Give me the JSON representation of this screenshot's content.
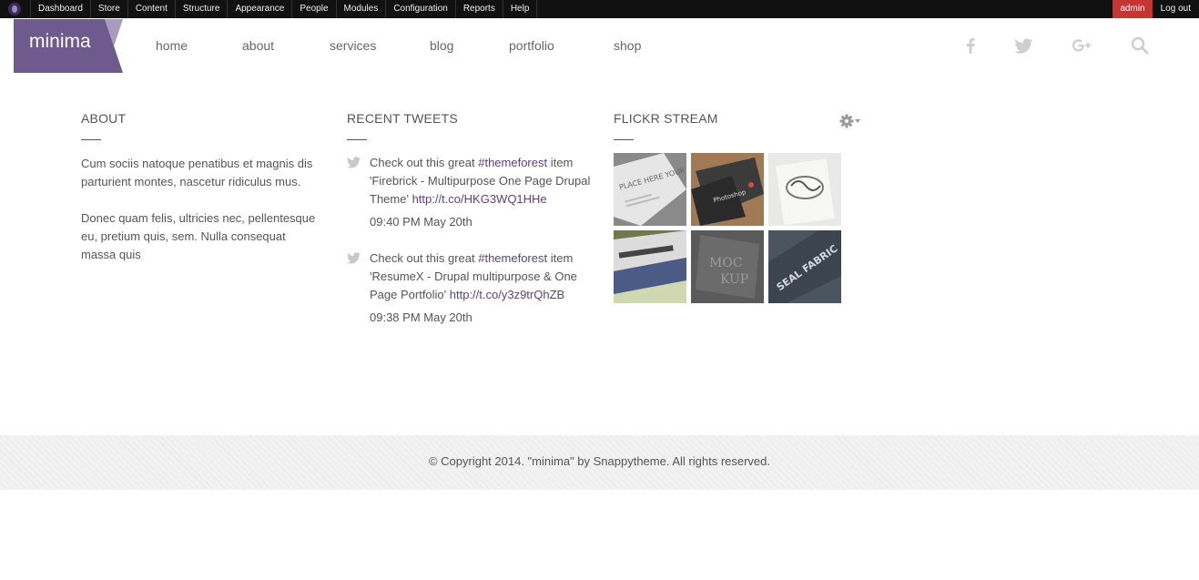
{
  "toolbar": {
    "items": [
      "Dashboard",
      "Store",
      "Content",
      "Structure",
      "Appearance",
      "People",
      "Modules",
      "Configuration",
      "Reports",
      "Help"
    ],
    "user": "admin",
    "logout": "Log out"
  },
  "header": {
    "logo": "minima",
    "nav": [
      "home",
      "about",
      "services",
      "blog",
      "portfolio",
      "shop"
    ],
    "social_icons": [
      "facebook-icon",
      "twitter-icon",
      "google-plus-icon",
      "search-icon"
    ]
  },
  "about": {
    "title": "ABOUT",
    "paragraphs": [
      "Cum sociis natoque penatibus et magnis dis parturient montes, nascetur ridiculus mus.",
      "Donec quam felis, ultricies nec, pellentesque eu, pretium quis, sem. Nulla consequat massa quis"
    ]
  },
  "tweets": {
    "title": "RECENT TWEETS",
    "items": [
      {
        "prefix": "Check out this great ",
        "hashtag": "#themeforest",
        "body": " item 'Firebrick - Multipurpose One Page Drupal Theme' ",
        "link": "http://t.co/HKG3WQ1HHe",
        "time": "09:40 PM May 20th"
      },
      {
        "prefix": "Check out this great ",
        "hashtag": "#themeforest",
        "body": " item 'ResumeX - Drupal multipurpose & One Page Portfolio' ",
        "link": "http://t.co/y3z9trQhZB",
        "time": "09:38 PM May 20th"
      }
    ]
  },
  "flickr": {
    "title": "FLICKR STREAM",
    "thumbs": [
      "PLACE HERE YOUR DESIGN",
      "Photoshop",
      "",
      "",
      "",
      "SEAL FABRIC"
    ]
  },
  "footer": {
    "text": "© Copyright 2014. \"minima\" by Snappytheme. All rights reserved."
  },
  "colors": {
    "brand_purple": "#6e5a8c",
    "link_purple": "#5e3f86",
    "admin_red": "#c63532"
  }
}
